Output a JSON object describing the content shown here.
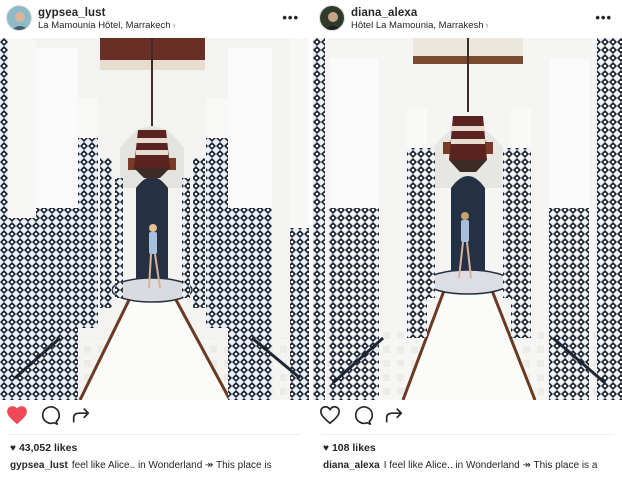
{
  "posts": [
    {
      "username": "gypsea_lust",
      "location": "La Mamounia Hôtel, Marrakech",
      "location_chevron": "›",
      "more_label": "•••",
      "liked": true,
      "like_color": "#ed4956",
      "likes_text": "43,052 likes",
      "caption_user": "gypsea_lust",
      "caption_text": "feel like Alice.. in Wonderland ↠ This place is"
    },
    {
      "username": "diana_alexa",
      "location": "Hôtel La Mamounia, Marrakesh",
      "location_chevron": "›",
      "more_label": "•••",
      "liked": false,
      "like_color": "#262626",
      "likes_text": "108 likes",
      "caption_user": "diana_alexa",
      "caption_text": "I feel like Alice.. in Wonderland ↠ This place is a"
    }
  ],
  "icons": {
    "heart_small": "♥",
    "like": "heart-icon",
    "comment": "comment-icon",
    "share": "share-icon"
  }
}
